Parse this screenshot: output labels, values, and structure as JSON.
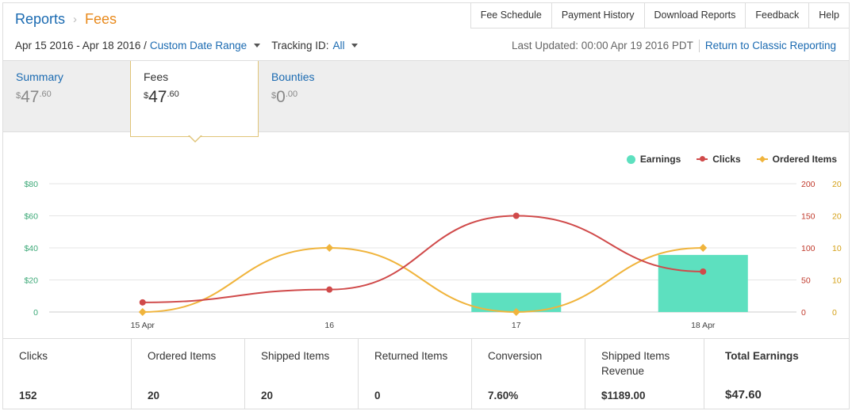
{
  "breadcrumb": {
    "reports": "Reports",
    "separator": "›",
    "current": "Fees"
  },
  "topnav": [
    "Fee Schedule",
    "Payment History",
    "Download Reports",
    "Feedback",
    "Help"
  ],
  "date_range": {
    "text": "Apr 15 2016 - Apr 18 2016 /",
    "selector": "Custom Date Range"
  },
  "tracking": {
    "label": "Tracking ID:",
    "value": "All"
  },
  "last_updated": "Last Updated: 00:00 Apr 19 2016 PDT",
  "classic_link": "Return to Classic Reporting",
  "tabs": [
    {
      "label": "Summary",
      "currency": "$",
      "int": "47",
      "dec": ".60"
    },
    {
      "label": "Fees",
      "currency": "$",
      "int": "47",
      "dec": ".60"
    },
    {
      "label": "Bounties",
      "currency": "$",
      "int": "0",
      "dec": ".00"
    }
  ],
  "chart_data": {
    "type": "bar",
    "categories": [
      "15 Apr",
      "16",
      "17",
      "18 Apr"
    ],
    "series": [
      {
        "name": "Earnings",
        "kind": "bar",
        "axis": "left",
        "values": [
          0,
          0,
          12,
          35.6
        ],
        "color": "#5de0bf"
      },
      {
        "name": "Clicks",
        "kind": "line",
        "axis": "right1",
        "values": [
          15,
          35,
          150,
          63
        ],
        "color": "#d04a4a"
      },
      {
        "name": "Ordered Items",
        "kind": "line",
        "axis": "right2",
        "values": [
          0,
          10,
          0,
          10
        ],
        "color": "#f0b43c"
      }
    ],
    "y_left": {
      "ticks": [
        "0",
        "$20",
        "$40",
        "$60",
        "$80"
      ],
      "max": 80,
      "color": "#3aa876"
    },
    "y_right1": {
      "ticks": [
        "0",
        "50",
        "100",
        "150",
        "200"
      ],
      "max": 200,
      "color": "#c0392b"
    },
    "y_right2": {
      "ticks": [
        "0",
        "10",
        "10",
        "20",
        "20"
      ],
      "max": 20,
      "color": "#d4a017"
    },
    "legend": "top-right"
  },
  "stats": [
    {
      "label": "Clicks",
      "value": "152"
    },
    {
      "label": "Ordered Items",
      "value": "20"
    },
    {
      "label": "Shipped Items",
      "value": "20"
    },
    {
      "label": "Returned Items",
      "value": "0"
    },
    {
      "label": "Conversion",
      "value": "7.60%"
    },
    {
      "label": "Shipped Items Revenue",
      "value": "$1189.00"
    },
    {
      "label": "Total Earnings",
      "value": "$47.60"
    }
  ]
}
